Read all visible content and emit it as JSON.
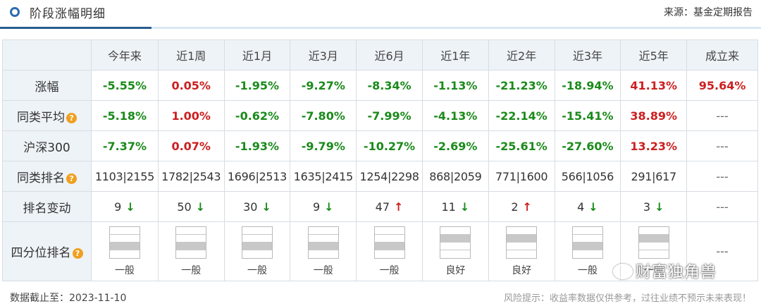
{
  "header": {
    "title": "阶段涨幅明细",
    "source": "来源：基金定期报告"
  },
  "columns": [
    "今年来",
    "近1周",
    "近1月",
    "近3月",
    "近6月",
    "近1年",
    "近2年",
    "近3年",
    "近5年",
    "成立来"
  ],
  "rows": {
    "change": {
      "label": "涨幅",
      "values": [
        "-5.55%",
        "0.05%",
        "-1.95%",
        "-9.27%",
        "-8.34%",
        "-1.13%",
        "-21.23%",
        "-18.94%",
        "41.13%",
        "95.64%"
      ]
    },
    "peer_avg": {
      "label": "同类平均",
      "help_icon": "question-icon",
      "values": [
        "-5.18%",
        "1.00%",
        "-0.62%",
        "-7.80%",
        "-7.99%",
        "-4.13%",
        "-22.14%",
        "-15.41%",
        "38.89%",
        "---"
      ]
    },
    "csi300": {
      "label": "沪深300",
      "values": [
        "-7.37%",
        "0.07%",
        "-1.93%",
        "-9.79%",
        "-10.27%",
        "-2.69%",
        "-25.61%",
        "-27.60%",
        "13.23%",
        "---"
      ]
    },
    "peer_rank": {
      "label": "同类排名",
      "help_icon": "question-icon",
      "values": [
        "1103|2155",
        "1782|2543",
        "1696|2513",
        "1635|2415",
        "1254|2298",
        "868|2059",
        "771|1600",
        "566|1056",
        "291|617",
        "---"
      ]
    },
    "rank_change": {
      "label": "排名变动",
      "values": [
        {
          "num": "9",
          "arrow": "↓",
          "dir": "down"
        },
        {
          "num": "50",
          "arrow": "↓",
          "dir": "down"
        },
        {
          "num": "30",
          "arrow": "↓",
          "dir": "down"
        },
        {
          "num": "9",
          "arrow": "↓",
          "dir": "down"
        },
        {
          "num": "47",
          "arrow": "↑",
          "dir": "up"
        },
        {
          "num": "11",
          "arrow": "↓",
          "dir": "down"
        },
        {
          "num": "2",
          "arrow": "↑",
          "dir": "up"
        },
        {
          "num": "4",
          "arrow": "↓",
          "dir": "down"
        },
        {
          "num": "3",
          "arrow": "↓",
          "dir": "down"
        },
        {
          "num": "---",
          "arrow": "",
          "dir": "none"
        }
      ]
    },
    "quartile": {
      "label": "四分位排名",
      "help_icon": "question-icon",
      "values": [
        {
          "label": "一般",
          "filled_quartile": 3
        },
        {
          "label": "一般",
          "filled_quartile": 3
        },
        {
          "label": "一般",
          "filled_quartile": 3
        },
        {
          "label": "一般",
          "filled_quartile": 3
        },
        {
          "label": "一般",
          "filled_quartile": 3
        },
        {
          "label": "良好",
          "filled_quartile": 2
        },
        {
          "label": "良好",
          "filled_quartile": 2
        },
        {
          "label": "一般",
          "filled_quartile": 3
        },
        {
          "label": "一般",
          "filled_quartile": 2
        },
        {
          "label": "---",
          "filled_quartile": 0
        }
      ]
    }
  },
  "footer": {
    "date": "数据截止至：2023-11-10",
    "risk": "风险提示：收益率数据仅供参考，过往业绩不预示未来表现！"
  },
  "watermark": "财富独角兽",
  "colors": {
    "positive": "#cc1f1f",
    "negative": "#1a8a1a",
    "accent": "#2a5d8f",
    "header_bg": "#eef3f8"
  }
}
